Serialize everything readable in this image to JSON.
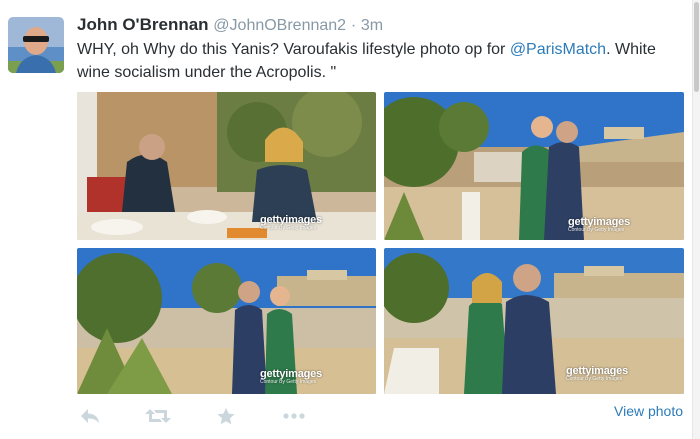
{
  "tweet": {
    "author_name": "John O'Brennan",
    "author_handle": "@JohnOBrennan2",
    "separator": "·",
    "timestamp": "3m",
    "text_before": "WHY, oh Why do this Yanis? Varoufakis lifestyle photo op for ",
    "mention": "@ParisMatch",
    "text_after": ". White wine socialism under the Acropolis. \""
  },
  "photos": [
    {
      "watermark": "gettyimages",
      "credit": "Contour By Getty Images"
    },
    {
      "watermark": "gettyimages",
      "credit": "Contour By Getty Images"
    },
    {
      "watermark": "gettyimages",
      "credit": "Contour By Getty Images"
    },
    {
      "watermark": "gettyimages",
      "credit": "Contour By Getty Images"
    }
  ],
  "actions": {
    "reply_icon": "reply-icon",
    "retweet_icon": "retweet-icon",
    "favorite_icon": "star-icon",
    "more_icon": "more-icon"
  },
  "view_photo_label": "View photo",
  "colors": {
    "link": "#2b7bb9",
    "meta": "#8899a6",
    "icon": "#ccd6dd",
    "text": "#292f33"
  }
}
